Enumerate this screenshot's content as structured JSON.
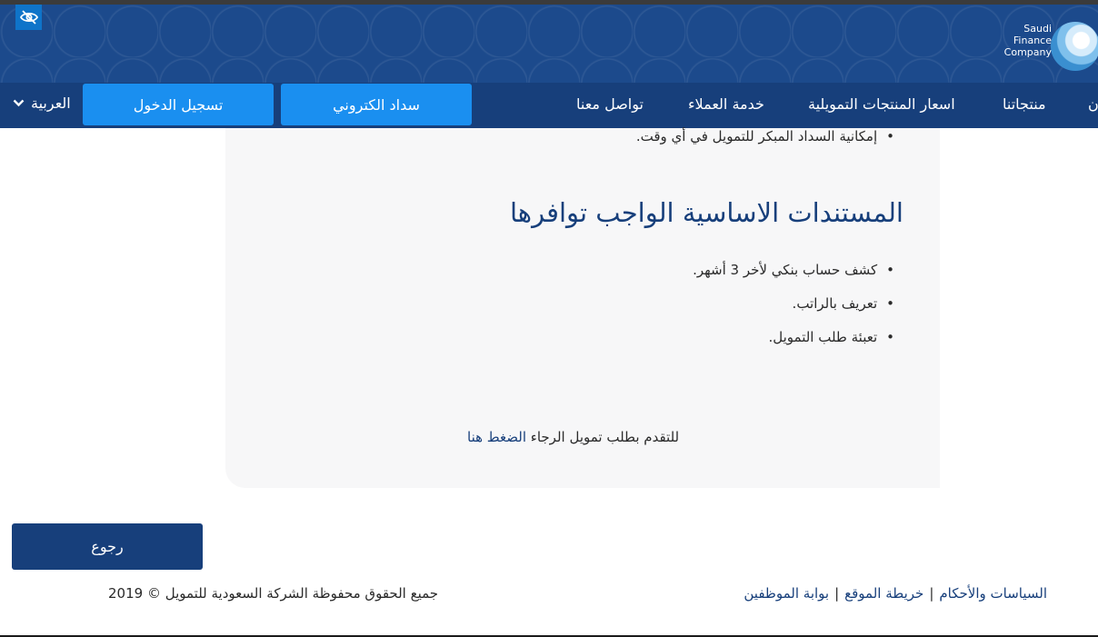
{
  "header": {
    "logo_lines": [
      "Saudi",
      "Finance",
      "Company"
    ],
    "nav_items": [
      "منتجاتنا",
      "اسعار المنتجات التمويلية",
      "خدمة العملاء",
      "تواصل معنا"
    ],
    "nav_partial": "ن",
    "pay_button": "سداد الكتروني",
    "login_button": "تسجيل الدخول",
    "language": "العربية",
    "colors": {
      "banner": "#1c4a8c",
      "navbar": "#173f7b",
      "button": "#1a8ff0"
    }
  },
  "accessibility_icon": "eye-slash-icon",
  "content": {
    "top_bullet": "إمكانية السداد المبكر للتمويل في أي وقت.",
    "heading": "المستندات الاساسية الواجب توافرها",
    "documents": [
      "كشف حساب بنكي لأخر 3 أشهر.",
      "تعريف بالراتب.",
      "تعبئة طلب التمويل."
    ],
    "apply_text": "للتقدم بطلب تمويل الرجاء",
    "apply_link": "الضغط هنا"
  },
  "back_button": "رجوع",
  "footer": {
    "links": [
      "السياسات والأحكام",
      "خريطة الموقع",
      "بوابة الموظفين"
    ],
    "separator": "|",
    "copyright": "جميع الحقوق محفوظة الشركة السعودية للتمويل © 2019"
  }
}
